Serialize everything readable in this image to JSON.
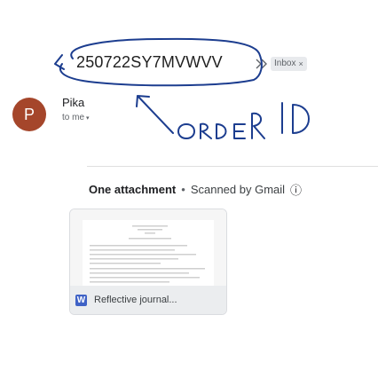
{
  "email": {
    "subject": "250722SY7MVWVV",
    "label_chip": "Inbox",
    "label_remove": "×",
    "sender": {
      "avatar_letter": "P",
      "avatar_color": "#a5462b",
      "name": "Pika",
      "recipient": "to me",
      "recipient_caret": "▾"
    }
  },
  "attachments": {
    "header": "One attachment",
    "separator": "•",
    "scan_note": "Scanned by Gmail",
    "info_icon": "ⓘ",
    "items": [
      {
        "name": "Reflective journal...",
        "type_letter": "W",
        "type_color": "#3f62c6"
      }
    ]
  },
  "annotation": {
    "text": "ORDER ID",
    "ink_color": "#1c3d8f"
  },
  "icons": {
    "importance": "importance-marker-icon",
    "info": "info-icon",
    "word": "word-doc-icon",
    "caret": "chevron-down-icon"
  }
}
